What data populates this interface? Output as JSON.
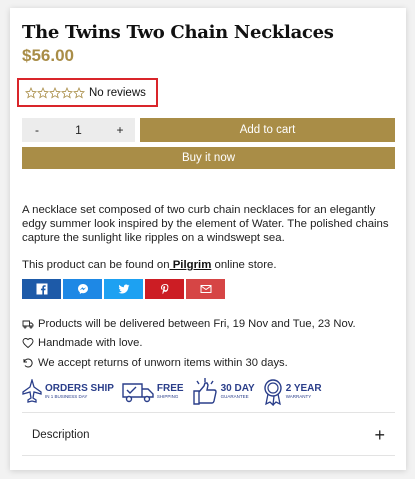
{
  "product": {
    "title": "The Twins Two Chain Necklaces",
    "price": "$56.00",
    "reviews_text": "No reviews",
    "rating": 0,
    "rating_max": 5
  },
  "purchase": {
    "minus_label": "-",
    "quantity": "1",
    "plus_label": "+",
    "add_to_cart_label": "Add to cart",
    "buy_now_label": "Buy it now"
  },
  "description": "A necklace set composed of two curb chain necklaces for an elegantly edgy summer look inspired by the element of Water. The polished chains capture the sunlight like ripples on a windswept sea.",
  "store_line": {
    "prefix": "This product can be found on",
    "store_name": " Pilgrim",
    "suffix": " online store."
  },
  "share_buttons": [
    {
      "icon": "facebook-icon",
      "color": "#1d5aa8"
    },
    {
      "icon": "messenger-icon",
      "color": "#1e88e5"
    },
    {
      "icon": "twitter-icon",
      "color": "#1da1f2"
    },
    {
      "icon": "pinterest-icon",
      "color": "#cc1d24"
    },
    {
      "icon": "email-icon",
      "color": "#d64545"
    }
  ],
  "info": {
    "delivery": "Products will be delivered between Fri, 19 Nov and Tue, 23 Nov.",
    "handmade": "Handmade with love.",
    "returns": "We accept returns of unworn items within 30 days."
  },
  "badges": [
    {
      "big": "ORDERS SHIP",
      "small": "IN 1 BUSINESS DAY",
      "icon": "airplane-icon"
    },
    {
      "big": "FREE",
      "small": "SHIPPING",
      "icon": "truck-icon"
    },
    {
      "big": "30 DAY",
      "small": "GUARANTEE",
      "icon": "thumbs-up-icon"
    },
    {
      "big": "2 YEAR",
      "small": "WARRANTY",
      "icon": "award-ribbon-icon"
    }
  ],
  "accordion": {
    "description_label": "Description",
    "toggle_symbol": "+"
  },
  "colors": {
    "accent": "#a98d47",
    "highlight_border": "#d9252a",
    "badge_blue": "#2a3e8a"
  }
}
